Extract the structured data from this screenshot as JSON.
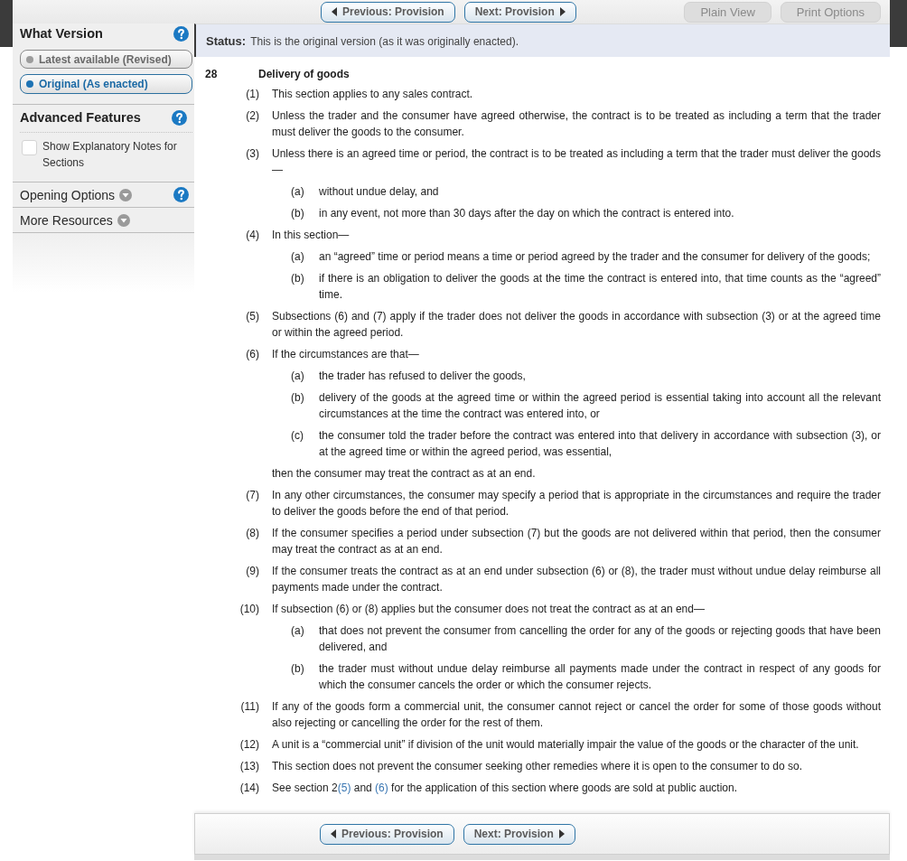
{
  "toolbar": {
    "buttons": [
      {
        "label": "Previous: Provision",
        "kind": "prev"
      },
      {
        "label": "Next: Provision",
        "kind": "next"
      },
      {
        "label": "Plain View",
        "kind": "tool"
      },
      {
        "label": "Print Options",
        "kind": "tool"
      }
    ]
  },
  "sidebar": {
    "sections": [
      {
        "kind": "version",
        "title": "What Version",
        "help": true,
        "options": [
          {
            "label": "Latest available (Revised)",
            "selected": false
          },
          {
            "label": "Original (As enacted)",
            "selected": true
          }
        ]
      },
      {
        "kind": "features",
        "title": "Advanced Features",
        "help": true,
        "checkboxes": [
          {
            "label": "Show Explanatory Notes for Sections",
            "checked": false
          }
        ]
      },
      {
        "kind": "menu",
        "title": "Opening Options",
        "help": true,
        "expanded": false
      },
      {
        "kind": "menu",
        "title": "More Resources",
        "help": false,
        "expanded": false
      }
    ]
  },
  "status": {
    "text": "**Status:** This is the original version (as it was originally enacted)."
  },
  "provision": {
    "number": "28",
    "heading": "Delivery of goods",
    "subsections": [
      {
        "number": "(1)",
        "text": "This section applies to any sales contract."
      },
      {
        "number": "(2)",
        "text": "Unless the trader and the consumer have agreed otherwise, the contract is to be treated as including a term that the trader must deliver the goods to the consumer."
      },
      {
        "number": "(3)",
        "text": "Unless there is an agreed time or period, the contract is to be treated as including a term that the trader must deliver the goods—",
        "items": [
          {
            "number": "(a)",
            "text": "without undue delay, and"
          },
          {
            "number": "(b)",
            "text": "in any event, not more than 30 days after the day on which the contract is entered into."
          }
        ]
      },
      {
        "number": "(4)",
        "text": "In this section—",
        "items": [
          {
            "number": "(a)",
            "text": "an “agreed” time or period means a time or period agreed by the trader and the consumer for delivery of the goods;"
          },
          {
            "number": "(b)",
            "text": "if there is an obligation to deliver the goods at the time the contract is entered into, that time counts as the “agreed” time."
          }
        ]
      },
      {
        "number": "(5)",
        "text": "Subsections (6) and (7) apply if the trader does not deliver the goods in accordance with subsection (3) or at the agreed time or within the agreed period."
      },
      {
        "number": "(6)",
        "text": "If the circumstances are that—",
        "items": [
          {
            "number": "(a)",
            "text": "the trader has refused to deliver the goods,"
          },
          {
            "number": "(b)",
            "text": "delivery of the goods at the agreed time or within the agreed period is essential taking into account all the relevant circumstances at the time the contract was entered into, or"
          },
          {
            "number": "(c)",
            "text": "the consumer told the trader before the contract was entered into that delivery in accordance with subsection (3), or at the agreed time or within the agreed period, was essential,"
          }
        ],
        "after": "then the consumer may treat the contract as at an end."
      },
      {
        "number": "(7)",
        "text": "In any other circumstances, the consumer may specify a period that is appropriate in the circumstances and require the trader to deliver the goods before the end of that period."
      },
      {
        "number": "(8)",
        "text": "If the consumer specifies a period under subsection (7) but the goods are not delivered within that period, then the consumer may treat the contract as at an end."
      },
      {
        "number": "(9)",
        "text": "If the consumer treats the contract as at an end under subsection (6) or (8), the trader must without undue delay reimburse all payments made under the contract."
      },
      {
        "number": "(10)",
        "text": "If subsection (6) or (8) applies but the consumer does not treat the contract as at an end—",
        "items": [
          {
            "number": "(a)",
            "text": "that does not prevent the consumer from cancelling the order for any of the goods or rejecting goods that have been delivered, and"
          },
          {
            "number": "(b)",
            "text": "the trader must without undue delay reimburse all payments made under the contract in respect of any goods for which the consumer cancels the order or which the consumer rejects."
          }
        ]
      },
      {
        "number": "(11)",
        "text": "If any of the goods form a commercial unit, the consumer cannot reject or cancel the order for some of those goods without also rejecting or cancelling the order for the rest of them."
      },
      {
        "number": "(12)",
        "text": "A unit is a “commercial unit” if division of the unit would materially impair the value of the goods or the character of the unit."
      },
      {
        "number": "(13)",
        "text": "This section does not prevent the consumer seeking other remedies where it is open to the consumer to do so."
      },
      {
        "number": "(14)",
        "segments": [
          {
            "kind": "plain",
            "text": "See section 2"
          },
          {
            "kind": "link",
            "text": "(5)"
          },
          {
            "kind": "plain",
            "text": " and "
          },
          {
            "kind": "link",
            "text": "(6)"
          },
          {
            "kind": "plain",
            "text": " for the application of this section where goods are sold at public auction."
          }
        ]
      }
    ]
  },
  "bottom_nav": {
    "buttons": [
      {
        "label": "Previous: Provision",
        "kind": "prev"
      },
      {
        "label": "Next: Provision",
        "kind": "next"
      }
    ]
  }
}
